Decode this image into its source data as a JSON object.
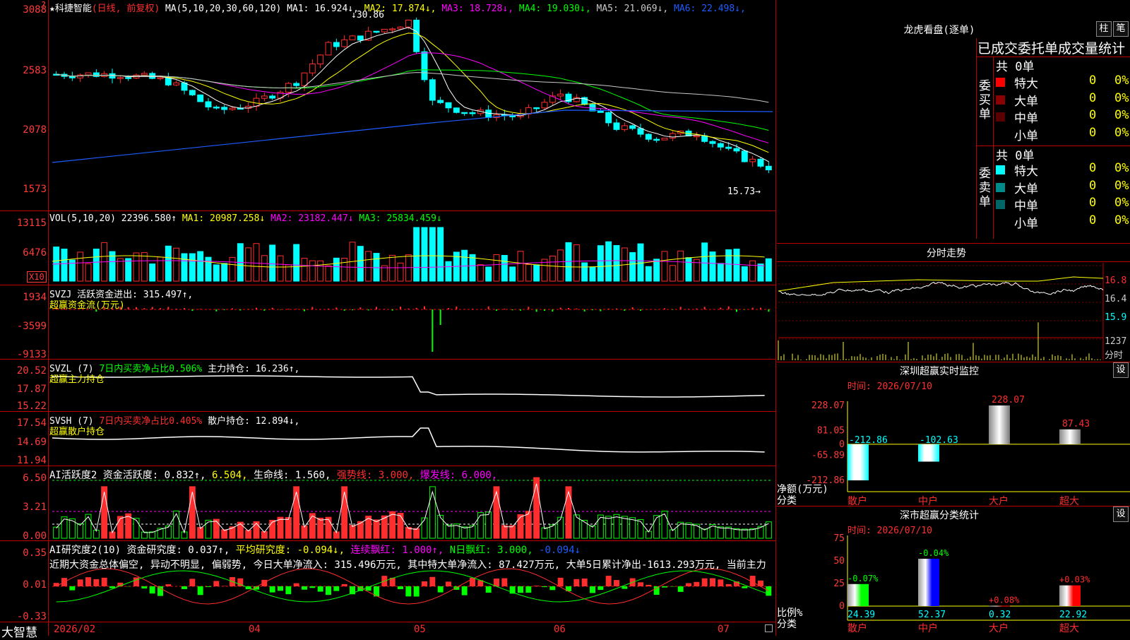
{
  "stock": {
    "name": "科捷智能",
    "adjust": "(日线, 前复权)",
    "star": "★"
  },
  "ma_bar": {
    "label": "MA(5,10,20,30,60,120)",
    "items": [
      {
        "t": "MA1: 16.924↓",
        "c": "#ffffff"
      },
      {
        "t": "MA2: 17.874↓",
        "c": "#ffff00"
      },
      {
        "t": "MA3: 18.728↓",
        "c": "#ff00ff"
      },
      {
        "t": "MA4: 19.030↓",
        "c": "#00ff00"
      },
      {
        "t": "MA5: 21.069↓",
        "c": "#c8c8c8"
      },
      {
        "t": "MA6: 22.498↓",
        "c": "#1e5cff"
      }
    ]
  },
  "price_axis": [
    "3088",
    "2583",
    "2078",
    "1573"
  ],
  "high_label": "30.86",
  "low_label": "15.73",
  "vol": {
    "label": "VOL(5,10,20)",
    "v": "22396.580↑",
    "ma1": "MA1: 20987.258↓",
    "ma2": "MA2: 23182.447↓",
    "ma3": "MA3: 25834.459↓",
    "axis": [
      "13115",
      "6476"
    ],
    "unit": "X10"
  },
  "svzj": {
    "label": "SVZJ",
    "t1": "活跃资金进出: 315.497↑,",
    "t2": "超赢资金流(万元)",
    "axis": [
      "1934",
      "-3599",
      "-9133"
    ]
  },
  "svzl": {
    "label": "SVZL (7)",
    "t1": "7日内买卖净占比0.506%",
    "t2": "主力持仓: 16.236↑,",
    "t3": "超赢主力持仓",
    "axis": [
      "20.52",
      "17.87",
      "15.22"
    ]
  },
  "svsh": {
    "label": "SVSH (7)",
    "t1": "7日内买卖净占比0.405%",
    "t2": "散户持仓: 12.894↓,",
    "t3": "超赢散户持仓",
    "axis": [
      "17.54",
      "14.69",
      "11.94"
    ]
  },
  "ai1": {
    "t0": "AI活跃度2",
    "t1": "资金活跃度: 0.832↑,",
    "t2": "6.504,",
    "t3": "生命线: 1.560,",
    "t4": "强势线: 3.000,",
    "t5": "爆发线: 6.000,",
    "axis": [
      "6.50",
      "3.21",
      "0.00"
    ]
  },
  "ai2": {
    "t0": "AI研究度2(10)",
    "t1": "资金研究度: 0.037↑,",
    "t2": "平均研究度: -0.094↓,",
    "t3": "连续飘红: 1.000↑,",
    "t4": "N日飘红: 3.000,",
    "t5": "-0.094↓",
    "axis": [
      "0.35",
      "0.01",
      "-0.33"
    ],
    "note": "近期大资金总体偏空, 异动不明显, 偏弱势, 今日大单净流入: 315.496万元, 其中特大单净流入: 87.427万元, 大单5日累计净出-1613.293万元, 当前主力"
  },
  "date_axis": [
    "2026/02",
    "04",
    "05",
    "06",
    "07"
  ],
  "brand": "大智慧",
  "lhb": {
    "title": "龙虎看盘(逐单)",
    "btn1": "柱",
    "btn2": "笔",
    "tabs": "已成交委托单成交量统计",
    "buy_label": "委买单",
    "sell_label": "委卖单",
    "buy_total": "共 0单",
    "sell_total": "共 0单",
    "buy_rows": [
      {
        "n": "特大",
        "a": "0",
        "b": "0%",
        "c": "#ff0000"
      },
      {
        "n": "大单",
        "a": "0",
        "b": "0%",
        "c": "#8b0000"
      },
      {
        "n": "中单",
        "a": "0",
        "b": "0%",
        "c": "#5a0000"
      },
      {
        "n": "小单",
        "a": "0",
        "b": "0%",
        "c": "#000000"
      }
    ],
    "sell_rows": [
      {
        "n": "特大",
        "a": "0",
        "b": "0%",
        "c": "#00ffff"
      },
      {
        "n": "大单",
        "a": "0",
        "b": "0%",
        "c": "#008b8b"
      },
      {
        "n": "中单",
        "a": "0",
        "b": "0%",
        "c": "#006666"
      },
      {
        "n": "小单",
        "a": "0",
        "b": "0%",
        "c": "#000000"
      }
    ]
  },
  "intraday": {
    "title": "分时走势",
    "axis": [
      "16.8",
      "16.4",
      "15.9"
    ],
    "vol_label": "1237",
    "vol_unit": "分时"
  },
  "monitor": {
    "title": "深圳超赢实时监控",
    "btn": "设",
    "time": "时间: 2026/07/10",
    "ylabels": [
      "228.07",
      "81.05",
      "0",
      "-65.89",
      "-212.86"
    ],
    "y_title": "净额(万元)",
    "x_title": "分类",
    "chart_data": {
      "type": "bar",
      "categories": [
        "散户",
        "中户",
        "大户",
        "超大"
      ],
      "values": [
        -212.86,
        -102.63,
        228.07,
        87.43
      ],
      "ylim": [
        -212.86,
        228.07
      ]
    }
  },
  "classify": {
    "title": "深市超赢分类统计",
    "btn": "设",
    "time": "时间: 2026/07/10",
    "ylabels": [
      "75",
      "50",
      "25",
      "0"
    ],
    "y_title": "比例%",
    "x_title": "分类",
    "chart_data": {
      "type": "bar",
      "categories": [
        "散户",
        "中户",
        "大户",
        "超大"
      ],
      "values": [
        24.39,
        52.37,
        0.32,
        22.92
      ],
      "changes": [
        "-0.07%",
        "-0.04%",
        "+0.08%",
        "+0.03%"
      ],
      "ylim": [
        0,
        75
      ]
    }
  }
}
